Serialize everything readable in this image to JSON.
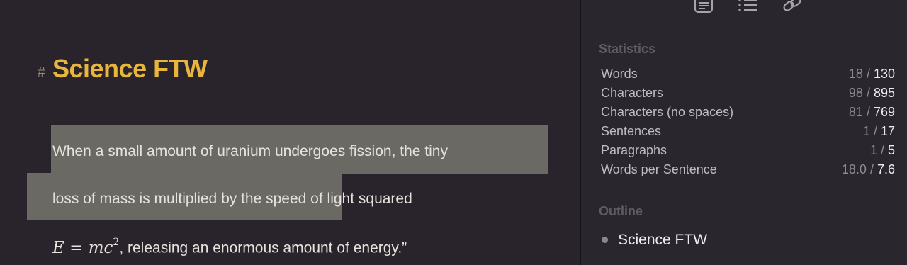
{
  "editor": {
    "heading_marker": "#",
    "heading": "Science FTW",
    "para_line1": "When a small amount of uranium undergoes fission, the tiny",
    "para_line2_selected": "loss of mass is multiplied by the speed",
    "para_line2_rest": " of light squared",
    "formula_lhs": "E",
    "formula_eq": " = ",
    "formula_rhs": "mc",
    "formula_exp": "2",
    "para_line3_rest": ", releasing an enormous amount of energy.”"
  },
  "sidebar": {
    "toolbar": [
      {
        "icon": "document-icon"
      },
      {
        "icon": "outline-list-icon"
      },
      {
        "icon": "link-icon"
      }
    ],
    "statistics_title": "Statistics",
    "stats": [
      {
        "label": "Words",
        "selected": "18",
        "sep": " / ",
        "total": "130"
      },
      {
        "label": "Characters",
        "selected": "98",
        "sep": " / ",
        "total": "895"
      },
      {
        "label": "Characters (no spaces)",
        "selected": "81",
        "sep": " / ",
        "total": "769"
      },
      {
        "label": "Sentences",
        "selected": "1",
        "sep": " / ",
        "total": "17"
      },
      {
        "label": "Paragraphs",
        "selected": "1",
        "sep": " / ",
        "total": "5"
      },
      {
        "label": "Words per Sentence",
        "selected": "18.0",
        "sep": " / ",
        "total": "7.6"
      }
    ],
    "outline_title": "Outline",
    "outline_items": [
      "Science FTW"
    ]
  },
  "colors": {
    "heading": "#e8b53d",
    "selection": "#6b6964",
    "editor_bg": "#29242b",
    "sidebar_bg": "#29272d"
  }
}
